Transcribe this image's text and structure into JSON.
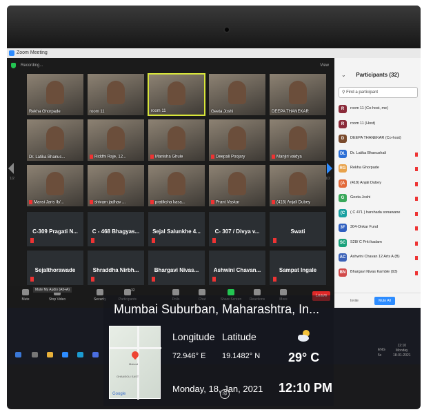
{
  "window": {
    "title": "Zoom Meeting"
  },
  "topbar": {
    "recording": "Recording...",
    "view": "View"
  },
  "gallery": {
    "video_tiles": [
      {
        "name": "Rekha Ghorpade",
        "muted": false
      },
      {
        "name": "room 11",
        "muted": false
      },
      {
        "name": "room 11",
        "muted": false,
        "active": true
      },
      {
        "name": "Geeta Joshi",
        "muted": false
      },
      {
        "name": "DEEPA THANEKAR",
        "muted": false
      },
      {
        "name": "Dr. Latika Bhanus...",
        "muted": false
      },
      {
        "name": "Riddhi Raje, 12...",
        "muted": true
      },
      {
        "name": "Manisha Ghule",
        "muted": true
      },
      {
        "name": "Deepali Poojary",
        "muted": true
      },
      {
        "name": "Manjiri vaidya",
        "muted": true
      },
      {
        "name": "Mansi Jaris /b/...",
        "muted": true
      },
      {
        "name": "shivam jadhav ...",
        "muted": true
      },
      {
        "name": "pratiksha kasa...",
        "muted": true
      },
      {
        "name": "Prant Vaskar",
        "muted": true
      },
      {
        "name": "(418) Anjali Dubey",
        "muted": true
      }
    ],
    "name_tiles": [
      {
        "name": "C-309 Pragati N..."
      },
      {
        "name": "C - 468 Bhagyas..."
      },
      {
        "name": "Sejal Salunkhe 4..."
      },
      {
        "name": "C- 307 / Divya v..."
      },
      {
        "name": "Swati"
      },
      {
        "name": "Sejalthorawade"
      },
      {
        "name": "Shraddha Nirbh..."
      },
      {
        "name": "Bhargavi Nivas..."
      },
      {
        "name": "Ashwini Chavan..."
      },
      {
        "name": "Sampat Ingale"
      }
    ],
    "page_left": "1/2",
    "page_right": "1/2"
  },
  "toolbar": {
    "tooltip": "Mute My Audio (Alt+A)",
    "buttons": [
      {
        "label": "Mute",
        "icon": "microphone-icon"
      },
      {
        "label": "Stop Video",
        "icon": "video-icon"
      },
      {
        "label": "Security",
        "icon": "shield-icon"
      },
      {
        "label": "Participants",
        "icon": "people-icon",
        "count": "32"
      },
      {
        "label": "Polls",
        "icon": "poll-icon"
      },
      {
        "label": "Chat",
        "icon": "chat-icon"
      },
      {
        "label": "Share Screen",
        "icon": "share-screen-icon"
      },
      {
        "label": "Reactions",
        "icon": "reaction-icon"
      },
      {
        "label": "More",
        "icon": "more-icon"
      }
    ],
    "leave": "Leave"
  },
  "participants": {
    "title": "Participants (32)",
    "search_placeholder": "Find a participant",
    "list": [
      {
        "initials": "R",
        "name": "room 11 (Co-host, me)",
        "color": "#8b2b3a"
      },
      {
        "initials": "R",
        "name": "room 11 (Host)",
        "color": "#8b2b3a"
      },
      {
        "initials": "D",
        "name": "DEEPA THANEKAR (Co-host)",
        "color": "#7a4a2c"
      },
      {
        "initials": "DL",
        "name": "Dr. Latika Bhanushali",
        "color": "#2d6fd6"
      },
      {
        "initials": "RG",
        "name": "Rekha Ghorpade",
        "color": "#e8a24a"
      },
      {
        "initials": "(A",
        "name": "(418) Anjali Dubey",
        "color": "#e26a3a"
      },
      {
        "initials": "G",
        "name": "Geeta Joshi",
        "color": "#3aa85a"
      },
      {
        "initials": "(C",
        "name": "( C 471 ) harshada sonawane",
        "color": "#18a0a0"
      },
      {
        "initials": "3F",
        "name": "304-Onkar Fund",
        "color": "#2f5fc0"
      },
      {
        "initials": "SC",
        "name": "S28/ C Priti kadam",
        "color": "#1aa17a"
      },
      {
        "initials": "AC",
        "name": "Ashwini Chavan 12 Arts A (B)",
        "color": "#3c62b8"
      },
      {
        "initials": "BN",
        "name": "Bhargavi Nivas Kamble (93)",
        "color": "#d24a4a"
      }
    ],
    "invite": "Invite",
    "mute_all": "Mute All"
  },
  "taskbar": {
    "time": "12:10",
    "day": "Monday",
    "date": "18-01-2021",
    "lang": "ENG",
    "vol": "5x"
  },
  "geotag": {
    "location": "Mumbai Suburban, Maharashtra, In...",
    "longitude_label": "Longitude",
    "latitude_label": "Latitude",
    "longitude": "72.946° E",
    "latitude": "19.1482° N",
    "temperature": "29° C",
    "date": "Monday, 18, Jan, 2021",
    "time": "12:10 PM",
    "map_pin_label": "Mulund",
    "map_area_label": "GHANSOLI EAST",
    "map_brand": "Google",
    "weather_icon": "partly-cloudy-icon",
    "laptop_logo": "hp"
  },
  "colors": {
    "zoom_blue": "#2d8cff",
    "leave_red": "#e02828",
    "active_speaker": "#d8e53a"
  }
}
